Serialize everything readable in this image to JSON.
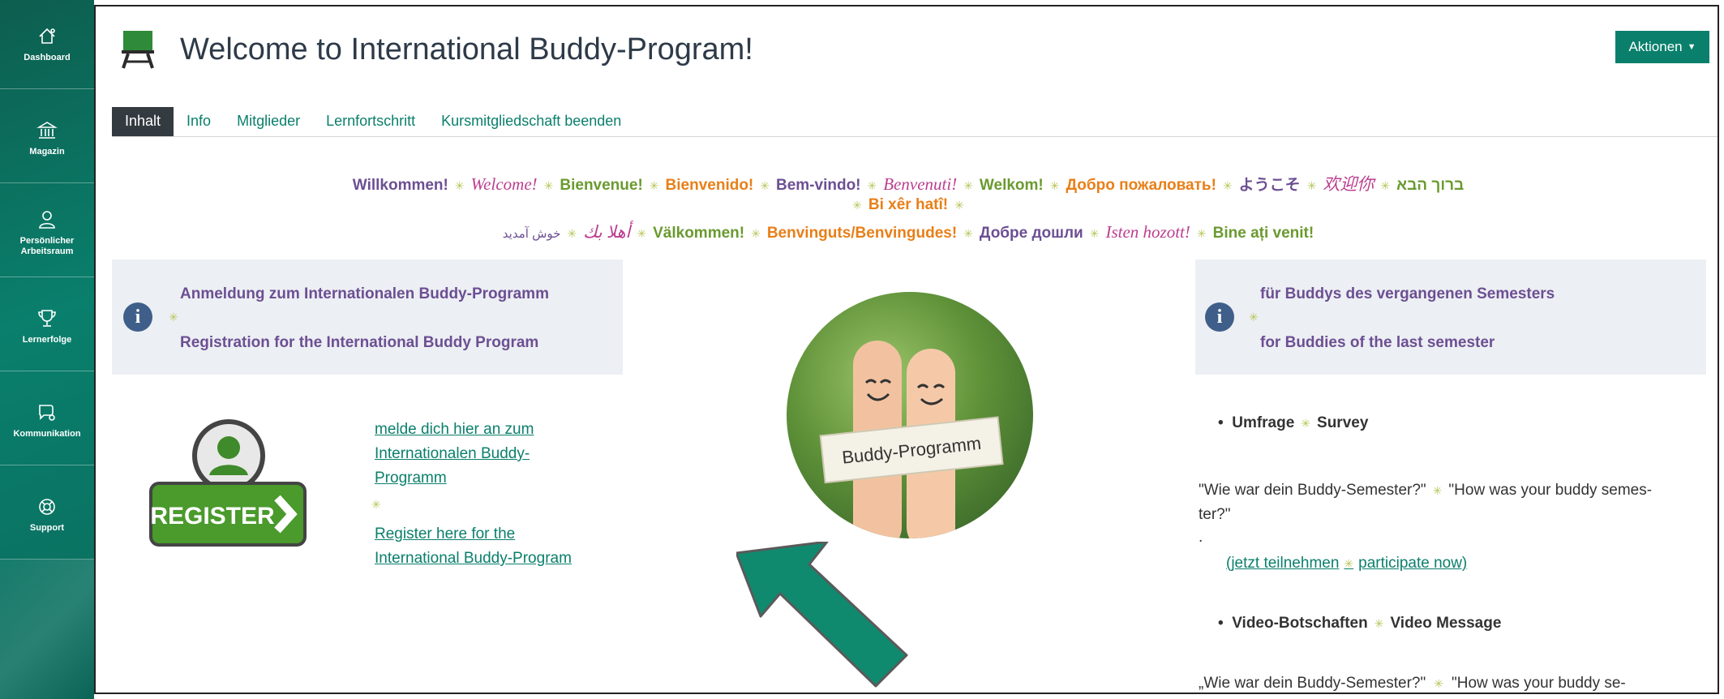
{
  "sidebar": {
    "items": [
      {
        "label": "Dashboard",
        "icon": "dashboard-icon"
      },
      {
        "label": "Magazin",
        "icon": "bank-icon"
      },
      {
        "label": "Persönlicher Arbeitsraum",
        "icon": "person-icon"
      },
      {
        "label": "Lernerfolge",
        "icon": "trophy-icon"
      },
      {
        "label": "Kommunikation",
        "icon": "chat-icon"
      },
      {
        "label": "Support",
        "icon": "lifebuoy-icon"
      }
    ]
  },
  "header": {
    "title": "Welcome to International Buddy-Program!",
    "actions_label": "Aktionen"
  },
  "tabs": [
    "Inhalt",
    "Info",
    "Mitglieder",
    "Lernfortschritt",
    "Kursmitgliedschaft beenden"
  ],
  "greetings": {
    "line1": [
      "Willkommen!",
      "Welcome!",
      "Bienvenue!",
      "Bienvenido!",
      "Bem-vindo!",
      "Benvenuti!",
      "Welkom!",
      "Добро пожаловать!",
      "ようこそ",
      "欢迎你",
      "ברוך הבא"
    ],
    "line2": "Bi xêr hatî!",
    "line3": [
      "أهلا بك",
      "خوش آمدید",
      "Välkommen!",
      "Benvinguts/Benvingudes!",
      "Добре дошли",
      "Isten hozott!",
      "Bine ați venit!"
    ]
  },
  "left_panel": {
    "line1": "Anmeldung zum Internationalen Buddy-Programm",
    "line2": "Registration for the International Buddy Program"
  },
  "register": {
    "button_label": "REGISTER",
    "link_de_lines": [
      "melde dich hier an zum",
      "Internationalen Buddy-",
      "Programm"
    ],
    "link_en_lines": [
      "Register here for the",
      "International Buddy-Program"
    ]
  },
  "buddy_image": {
    "sign_text": "Buddy-Programm"
  },
  "right_panel": {
    "line1": "für Buddys des vergangenen Semesters",
    "line2": "for Buddies of the last semester"
  },
  "right_content": {
    "survey_de": "Umfrage",
    "survey_en": "Survey",
    "survey_text_line1": "\"Wie war dein Buddy-Semester?\"",
    "survey_text_line1b": "\"How was your buddy semes-",
    "survey_text_line2": "ter?\"",
    "dot": ".",
    "participate_de": "(jetzt teilnehmen",
    "participate_en": "participate now)",
    "video_de": "Video-Botschaften",
    "video_en": "Video Message",
    "video_text_a": "„Wie war dein Buddy-Semester?\"",
    "video_text_b": "\"How was your buddy se-"
  },
  "colors": {
    "accent": "#0a7f6c",
    "purple": "#6c4f93",
    "green": "#6a9a2f",
    "orange": "#e87f18",
    "pink": "#bc3e8f",
    "tab_active": "#333a40",
    "panel_bg": "#eceff3",
    "info_icon": "#3f5f8a"
  }
}
